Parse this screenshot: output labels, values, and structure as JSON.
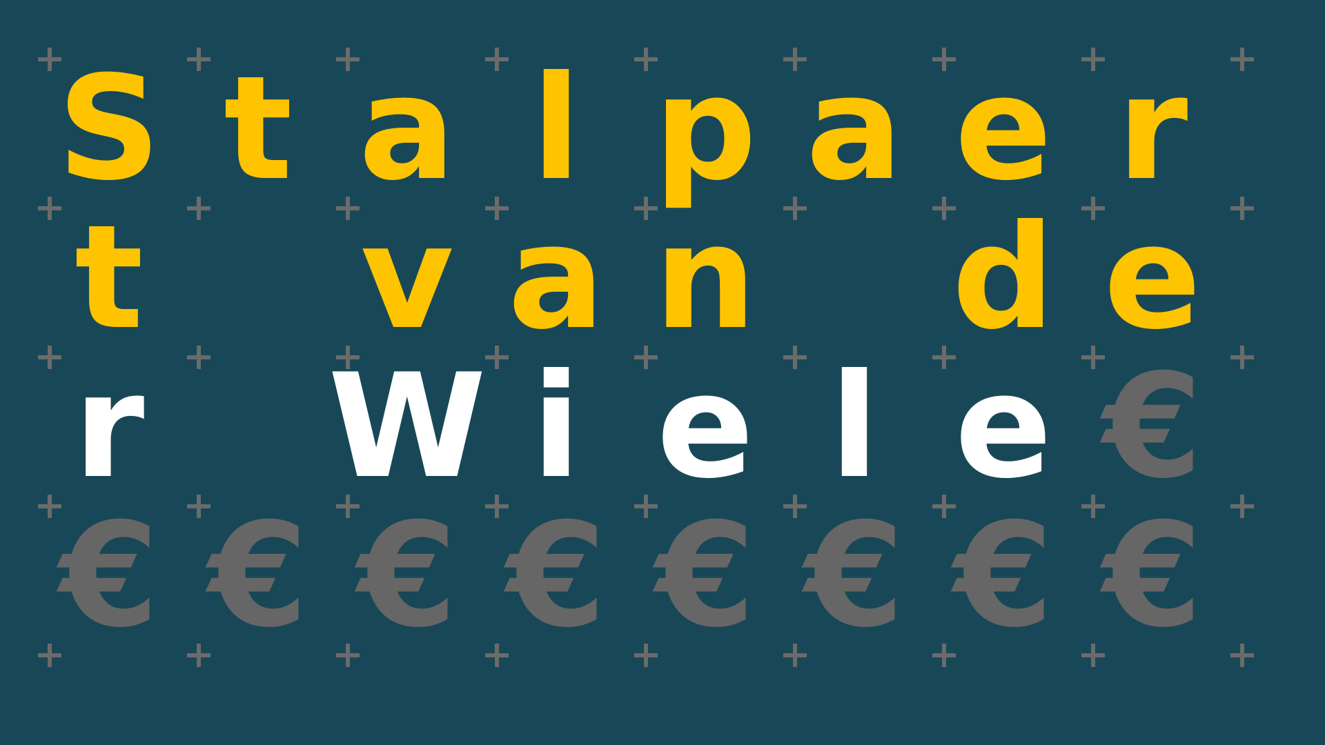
{
  "game": {
    "colors": {
      "background": "#184857",
      "plus_marker": "#6b6b6b",
      "given_letter": "#ffc400",
      "typed_letter": "#ffffff",
      "hidden_placeholder": "#666666"
    },
    "grid_columns": 8,
    "grid_rows": 4,
    "hidden_glyph": "€",
    "tiles": [
      {
        "char": "S",
        "state": "given"
      },
      {
        "char": "t",
        "state": "given"
      },
      {
        "char": "a",
        "state": "given"
      },
      {
        "char": "l",
        "state": "given"
      },
      {
        "char": "p",
        "state": "given"
      },
      {
        "char": "a",
        "state": "given"
      },
      {
        "char": "e",
        "state": "given"
      },
      {
        "char": "r",
        "state": "given"
      },
      {
        "char": "t",
        "state": "given"
      },
      {
        "char": "",
        "state": "empty"
      },
      {
        "char": "v",
        "state": "given"
      },
      {
        "char": "a",
        "state": "given"
      },
      {
        "char": "n",
        "state": "given"
      },
      {
        "char": "",
        "state": "empty"
      },
      {
        "char": "d",
        "state": "given"
      },
      {
        "char": "e",
        "state": "given"
      },
      {
        "char": "r",
        "state": "typed"
      },
      {
        "char": "",
        "state": "empty"
      },
      {
        "char": "W",
        "state": "typed"
      },
      {
        "char": "i",
        "state": "typed"
      },
      {
        "char": "e",
        "state": "typed"
      },
      {
        "char": "l",
        "state": "typed"
      },
      {
        "char": "e",
        "state": "typed"
      },
      {
        "char": "€",
        "state": "hidden"
      },
      {
        "char": "€",
        "state": "hidden"
      },
      {
        "char": "€",
        "state": "hidden"
      },
      {
        "char": "€",
        "state": "hidden"
      },
      {
        "char": "€",
        "state": "hidden"
      },
      {
        "char": "€",
        "state": "hidden"
      },
      {
        "char": "€",
        "state": "hidden"
      },
      {
        "char": "€",
        "state": "hidden"
      },
      {
        "char": "€",
        "state": "hidden"
      }
    ]
  }
}
